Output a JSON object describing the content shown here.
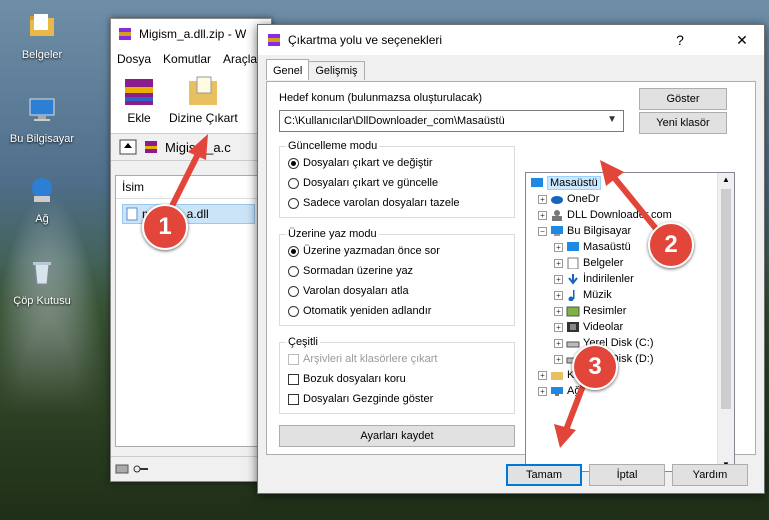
{
  "desktop": {
    "icons": [
      {
        "label": "Belgeler"
      },
      {
        "label": "Bu Bilgisayar"
      },
      {
        "label": "Ağ"
      },
      {
        "label": "Çöp Kutusu"
      }
    ]
  },
  "winrar": {
    "title": "Migism_a.dll.zip - W",
    "menu": [
      "Dosya",
      "Komutlar",
      "Araçla"
    ],
    "toolbar": {
      "add": "Ekle",
      "extract": "Dizine Çıkart"
    },
    "path": "Migism_a.c",
    "list_header": "İsim",
    "file": "migism_a.dll"
  },
  "dialog": {
    "title": "Çıkartma yolu ve seçenekleri",
    "tabs": [
      "Genel",
      "Gelişmiş"
    ],
    "dest_label": "Hedef konum (bulunmazsa oluşturulacak)",
    "dest_value": "C:\\Kullanıcılar\\DllDownloader_com\\Masaüstü",
    "show_button": "Göster",
    "new_folder_button": "Yeni klasör",
    "update_mode": {
      "title": "Güncelleme modu",
      "options": [
        "Dosyaları çıkart ve değiştir",
        "Dosyaları çıkart ve güncelle",
        "Sadece varolan dosyaları tazele"
      ],
      "selected": 0
    },
    "overwrite_mode": {
      "title": "Üzerine yaz modu",
      "options": [
        "Üzerine yazmadan önce sor",
        "Sormadan üzerine yaz",
        "Varolan dosyaları atla",
        "Otomatik yeniden adlandır"
      ],
      "selected": 0
    },
    "misc": {
      "title": "Çeşitli",
      "options": [
        "Arşivleri alt klasörlere çıkart",
        "Bozuk dosyaları koru",
        "Dosyaları Gezginde göster"
      ]
    },
    "save_settings": "Ayarları kaydet",
    "tree": [
      "Masaüstü",
      "OneDr",
      "DLL Downloader.com",
      "Bu Bilgisayar",
      "Masaüstü",
      "Belgeler",
      "İndirilenler",
      "Müzik",
      "Resimler",
      "Videolar",
      "Yerel Disk (C:)",
      "Yerel Disk (D:)",
      "Kitaplıklar",
      "Ağ"
    ],
    "ok": "Tamam",
    "cancel": "İptal",
    "help": "Yardım"
  },
  "badges": [
    "1",
    "2",
    "3"
  ],
  "colors": {
    "badge": "#e2463a",
    "arrow": "#e2463a",
    "selection": "#cce8ff"
  }
}
